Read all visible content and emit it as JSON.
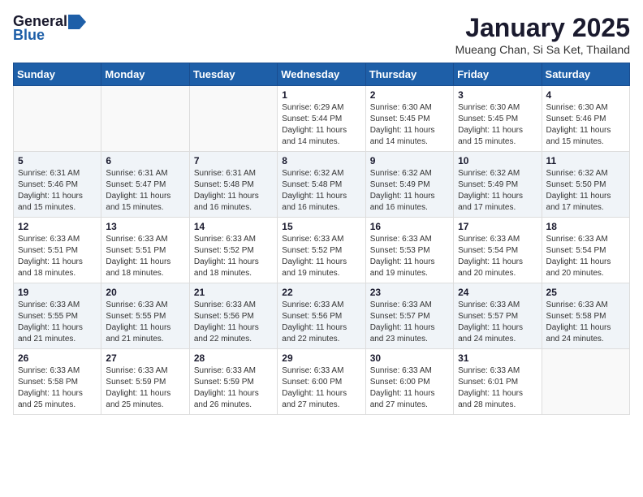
{
  "header": {
    "logo_general": "General",
    "logo_blue": "Blue",
    "title": "January 2025",
    "subtitle": "Mueang Chan, Si Sa Ket, Thailand"
  },
  "calendar": {
    "days_of_week": [
      "Sunday",
      "Monday",
      "Tuesday",
      "Wednesday",
      "Thursday",
      "Friday",
      "Saturday"
    ],
    "weeks": [
      [
        {
          "day": "",
          "info": ""
        },
        {
          "day": "",
          "info": ""
        },
        {
          "day": "",
          "info": ""
        },
        {
          "day": "1",
          "info": "Sunrise: 6:29 AM\nSunset: 5:44 PM\nDaylight: 11 hours and 14 minutes."
        },
        {
          "day": "2",
          "info": "Sunrise: 6:30 AM\nSunset: 5:45 PM\nDaylight: 11 hours and 14 minutes."
        },
        {
          "day": "3",
          "info": "Sunrise: 6:30 AM\nSunset: 5:45 PM\nDaylight: 11 hours and 15 minutes."
        },
        {
          "day": "4",
          "info": "Sunrise: 6:30 AM\nSunset: 5:46 PM\nDaylight: 11 hours and 15 minutes."
        }
      ],
      [
        {
          "day": "5",
          "info": "Sunrise: 6:31 AM\nSunset: 5:46 PM\nDaylight: 11 hours and 15 minutes."
        },
        {
          "day": "6",
          "info": "Sunrise: 6:31 AM\nSunset: 5:47 PM\nDaylight: 11 hours and 15 minutes."
        },
        {
          "day": "7",
          "info": "Sunrise: 6:31 AM\nSunset: 5:48 PM\nDaylight: 11 hours and 16 minutes."
        },
        {
          "day": "8",
          "info": "Sunrise: 6:32 AM\nSunset: 5:48 PM\nDaylight: 11 hours and 16 minutes."
        },
        {
          "day": "9",
          "info": "Sunrise: 6:32 AM\nSunset: 5:49 PM\nDaylight: 11 hours and 16 minutes."
        },
        {
          "day": "10",
          "info": "Sunrise: 6:32 AM\nSunset: 5:49 PM\nDaylight: 11 hours and 17 minutes."
        },
        {
          "day": "11",
          "info": "Sunrise: 6:32 AM\nSunset: 5:50 PM\nDaylight: 11 hours and 17 minutes."
        }
      ],
      [
        {
          "day": "12",
          "info": "Sunrise: 6:33 AM\nSunset: 5:51 PM\nDaylight: 11 hours and 18 minutes."
        },
        {
          "day": "13",
          "info": "Sunrise: 6:33 AM\nSunset: 5:51 PM\nDaylight: 11 hours and 18 minutes."
        },
        {
          "day": "14",
          "info": "Sunrise: 6:33 AM\nSunset: 5:52 PM\nDaylight: 11 hours and 18 minutes."
        },
        {
          "day": "15",
          "info": "Sunrise: 6:33 AM\nSunset: 5:52 PM\nDaylight: 11 hours and 19 minutes."
        },
        {
          "day": "16",
          "info": "Sunrise: 6:33 AM\nSunset: 5:53 PM\nDaylight: 11 hours and 19 minutes."
        },
        {
          "day": "17",
          "info": "Sunrise: 6:33 AM\nSunset: 5:54 PM\nDaylight: 11 hours and 20 minutes."
        },
        {
          "day": "18",
          "info": "Sunrise: 6:33 AM\nSunset: 5:54 PM\nDaylight: 11 hours and 20 minutes."
        }
      ],
      [
        {
          "day": "19",
          "info": "Sunrise: 6:33 AM\nSunset: 5:55 PM\nDaylight: 11 hours and 21 minutes."
        },
        {
          "day": "20",
          "info": "Sunrise: 6:33 AM\nSunset: 5:55 PM\nDaylight: 11 hours and 21 minutes."
        },
        {
          "day": "21",
          "info": "Sunrise: 6:33 AM\nSunset: 5:56 PM\nDaylight: 11 hours and 22 minutes."
        },
        {
          "day": "22",
          "info": "Sunrise: 6:33 AM\nSunset: 5:56 PM\nDaylight: 11 hours and 22 minutes."
        },
        {
          "day": "23",
          "info": "Sunrise: 6:33 AM\nSunset: 5:57 PM\nDaylight: 11 hours and 23 minutes."
        },
        {
          "day": "24",
          "info": "Sunrise: 6:33 AM\nSunset: 5:57 PM\nDaylight: 11 hours and 24 minutes."
        },
        {
          "day": "25",
          "info": "Sunrise: 6:33 AM\nSunset: 5:58 PM\nDaylight: 11 hours and 24 minutes."
        }
      ],
      [
        {
          "day": "26",
          "info": "Sunrise: 6:33 AM\nSunset: 5:58 PM\nDaylight: 11 hours and 25 minutes."
        },
        {
          "day": "27",
          "info": "Sunrise: 6:33 AM\nSunset: 5:59 PM\nDaylight: 11 hours and 25 minutes."
        },
        {
          "day": "28",
          "info": "Sunrise: 6:33 AM\nSunset: 5:59 PM\nDaylight: 11 hours and 26 minutes."
        },
        {
          "day": "29",
          "info": "Sunrise: 6:33 AM\nSunset: 6:00 PM\nDaylight: 11 hours and 27 minutes."
        },
        {
          "day": "30",
          "info": "Sunrise: 6:33 AM\nSunset: 6:00 PM\nDaylight: 11 hours and 27 minutes."
        },
        {
          "day": "31",
          "info": "Sunrise: 6:33 AM\nSunset: 6:01 PM\nDaylight: 11 hours and 28 minutes."
        },
        {
          "day": "",
          "info": ""
        }
      ]
    ]
  }
}
